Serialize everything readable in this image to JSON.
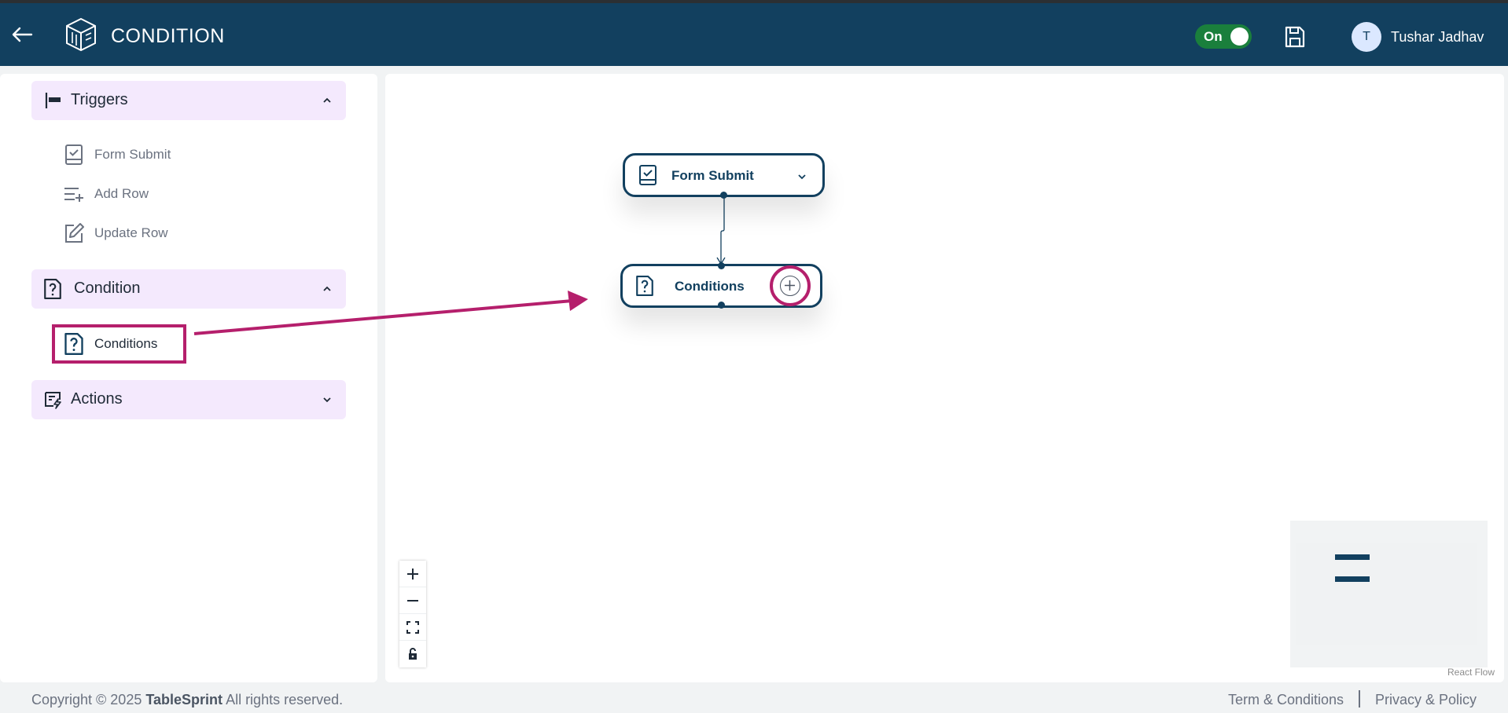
{
  "header": {
    "title": "CONDITION",
    "toggle_label": "On",
    "user": {
      "initial": "T",
      "name": "Tushar Jadhav"
    }
  },
  "sidebar": {
    "sections": [
      {
        "label": "Triggers",
        "icon": "flag-icon",
        "expanded": true,
        "items": [
          {
            "label": "Form Submit",
            "icon": "form-check-icon"
          },
          {
            "label": "Add Row",
            "icon": "list-add-icon"
          },
          {
            "label": "Update Row",
            "icon": "edit-icon"
          }
        ]
      },
      {
        "label": "Condition",
        "icon": "question-doc-icon",
        "expanded": true,
        "items": [
          {
            "label": "Conditions",
            "icon": "question-doc-icon"
          }
        ]
      },
      {
        "label": "Actions",
        "icon": "action-doc-icon",
        "expanded": false,
        "items": []
      }
    ]
  },
  "flow": {
    "nodes": [
      {
        "label": "Form Submit",
        "icon": "form-check-icon"
      },
      {
        "label": "Conditions",
        "icon": "question-doc-icon"
      }
    ],
    "attribution": "React Flow"
  },
  "colors": {
    "header": "#12405f",
    "accent": "#b51f6c",
    "section_bg": "#f4e9fd",
    "toggle_on": "#1a7f3c"
  },
  "footer": {
    "copyright_prefix": "Copyright © 2025",
    "brand": "TableSprint",
    "copyright_suffix": "All rights reserved.",
    "links": [
      "Term & Conditions",
      "Privacy & Policy"
    ]
  }
}
